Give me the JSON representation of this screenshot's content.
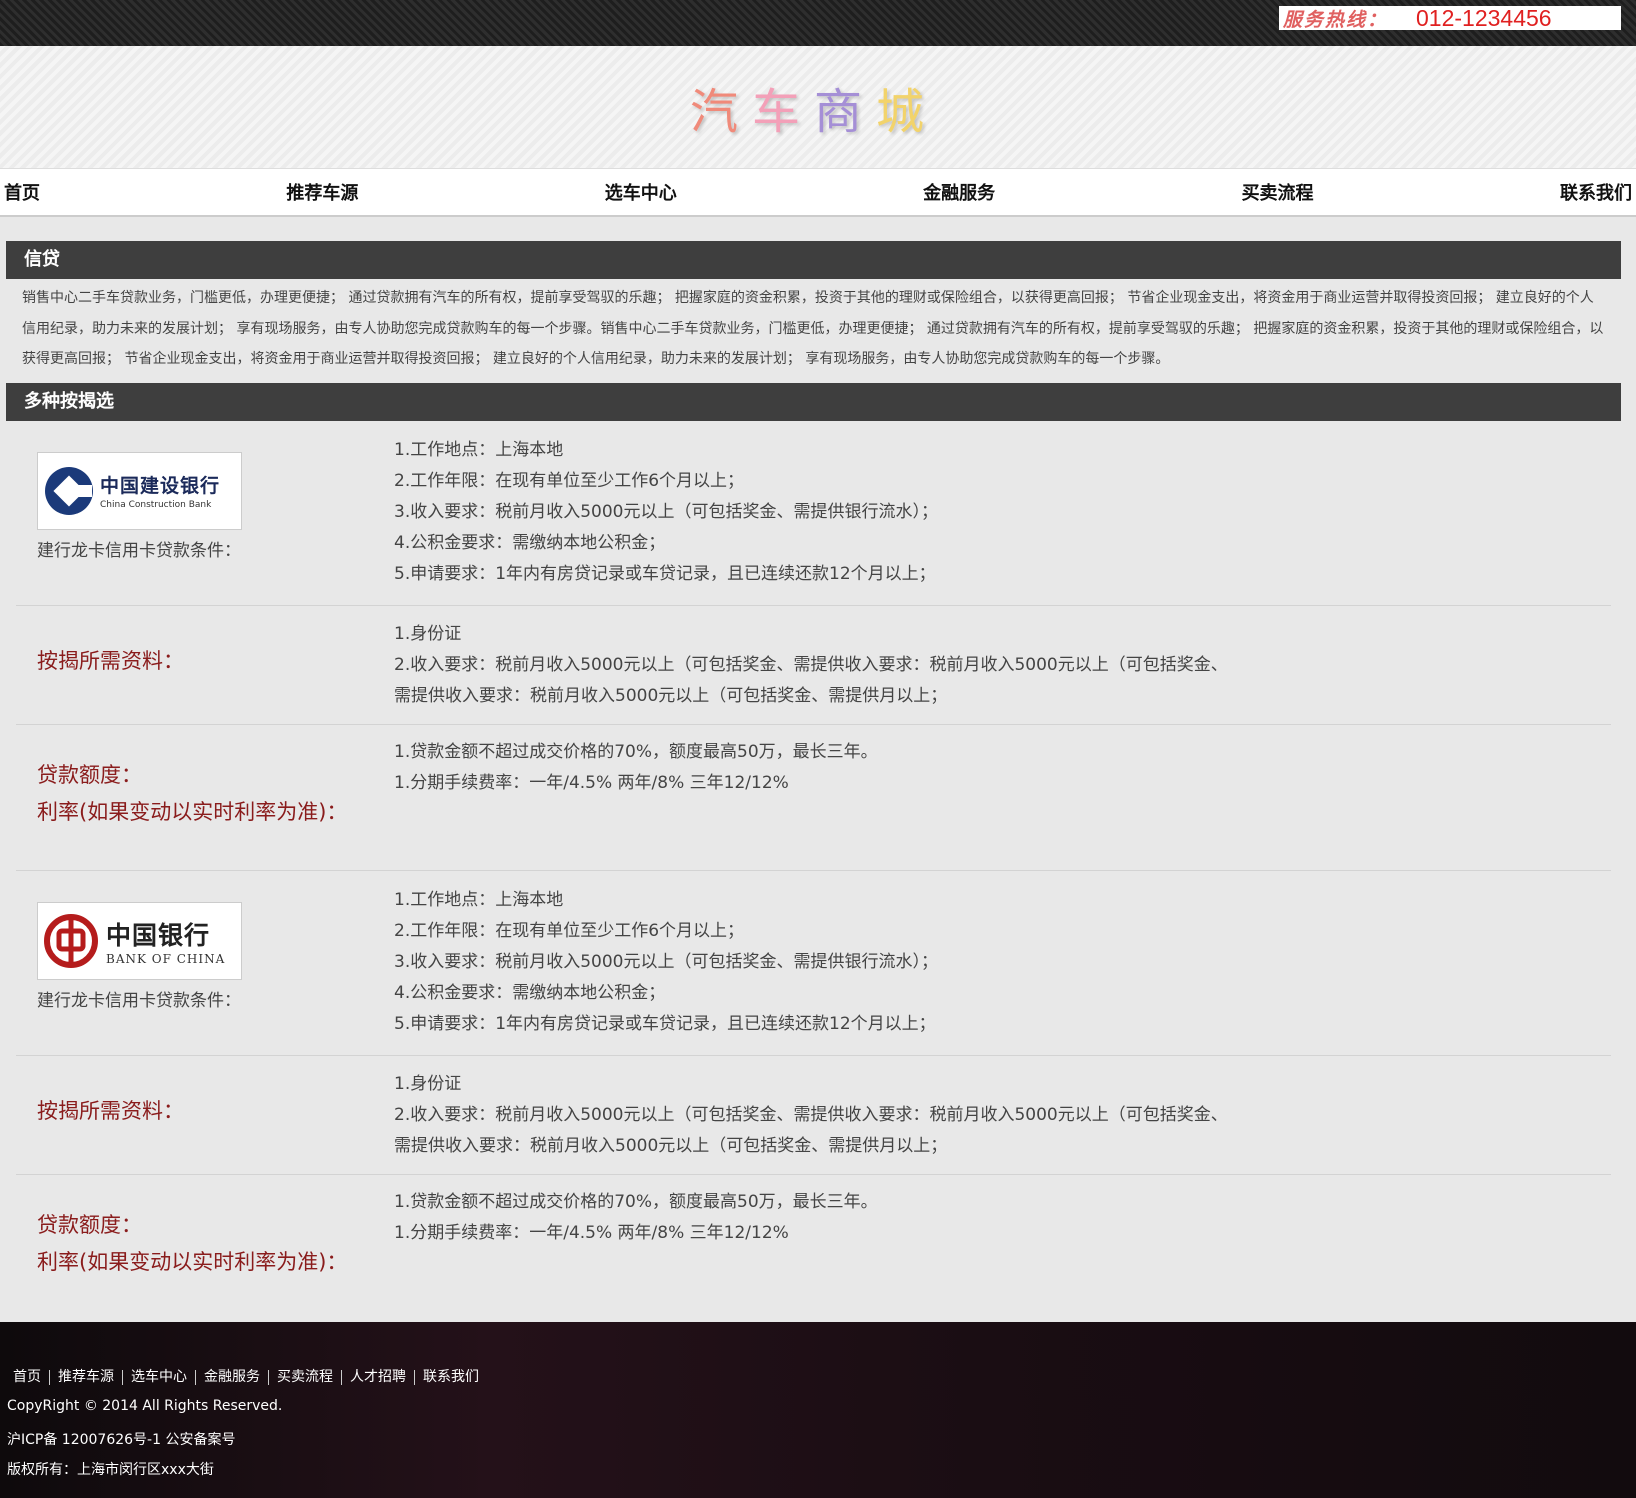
{
  "hotline": {
    "label": "服务热线：",
    "number": "012-1234456"
  },
  "logo": {
    "chars": [
      "汽",
      "车",
      "商",
      "城"
    ],
    "colors": [
      "#f08a7a",
      "#f3a0b8",
      "#a58fd6",
      "#f2d36b"
    ]
  },
  "nav": [
    "首页",
    "推荐车源",
    "选车中心",
    "金融服务",
    "买卖流程",
    "联系我们"
  ],
  "credit": {
    "title": "信贷",
    "text": "销售中心二手车贷款业务，门槛更低，办理更便捷； 通过贷款拥有汽车的所有权，提前享受驾驭的乐趣； 把握家庭的资金积累，投资于其他的理财或保险组合，以获得更高回报； 节省企业现金支出，将资金用于商业运营并取得投资回报； 建立良好的个人信用纪录，助力未来的发展计划； 享有现场服务，由专人协助您完成贷款购车的每一个步骤。销售中心二手车贷款业务，门槛更低，办理更便捷； 通过贷款拥有汽车的所有权，提前享受驾驭的乐趣； 把握家庭的资金积累，投资于其他的理财或保险组合，以获得更高回报； 节省企业现金支出，将资金用于商业运营并取得投资回报； 建立良好的个人信用纪录，助力未来的发展计划； 享有现场服务，由专人协助您完成贷款购车的每一个步骤。"
  },
  "options_title": "多种按揭选",
  "banks": [
    {
      "logo_cn": "中国建设银行",
      "logo_en": "China Construction Bank",
      "caption": "建行龙卡信用卡贷款条件：",
      "conditions": [
        "1.工作地点：上海本地",
        "2.工作年限：在现有单位至少工作6个月以上；",
        "3.收入要求：税前月收入5000元以上（可包括奖金、需提供银行流水）；",
        "4.公积金要求：需缴纳本地公积金；",
        "5.申请要求：1年内有房贷记录或车贷记录，且已连续还款12个月以上；"
      ],
      "materials_label": "按揭所需资料：",
      "materials": [
        "1.身份证",
        "2.收入要求：税前月收入5000元以上（可包括奖金、需提供收入要求：税前月收入5000元以上（可包括奖金、需提供收入要求：税前月收入5000元以上（可包括奖金、需提供月以上；"
      ],
      "amount_label": "贷款额度：",
      "rate_label": "利率(如果变动以实时利率为准)：",
      "amount_lines": [
        "1.贷款金额不超过成交价格的70%，额度最高50万，最长三年。",
        "1.分期手续费率：一年/4.5% 两年/8% 三年12/12%"
      ]
    },
    {
      "logo_cn": "中国银行",
      "logo_en": "BANK OF CHINA",
      "caption": "建行龙卡信用卡贷款条件：",
      "conditions": [
        "1.工作地点：上海本地",
        "2.工作年限：在现有单位至少工作6个月以上；",
        "3.收入要求：税前月收入5000元以上（可包括奖金、需提供银行流水）；",
        "4.公积金要求：需缴纳本地公积金；",
        "5.申请要求：1年内有房贷记录或车贷记录，且已连续还款12个月以上；"
      ],
      "materials_label": "按揭所需资料：",
      "materials": [
        "1.身份证",
        "2.收入要求：税前月收入5000元以上（可包括奖金、需提供收入要求：税前月收入5000元以上（可包括奖金、需提供收入要求：税前月收入5000元以上（可包括奖金、需提供月以上；"
      ],
      "amount_label": "贷款额度：",
      "rate_label": "利率(如果变动以实时利率为准)：",
      "amount_lines": [
        "1.贷款金额不超过成交价格的70%，额度最高50万，最长三年。",
        "1.分期手续费率：一年/4.5% 两年/8% 三年12/12%"
      ]
    }
  ],
  "footer": {
    "links": [
      "首页",
      "推荐车源",
      "选车中心",
      "金融服务",
      "买卖流程",
      "人才招聘",
      "联系我们"
    ],
    "copyright": "CopyRight © 2014 All Rights Reserved.",
    "icp": "沪ICP备 12007626号-1 公安备案号",
    "owner": "版权所有：上海市闵行区xxx大街"
  }
}
